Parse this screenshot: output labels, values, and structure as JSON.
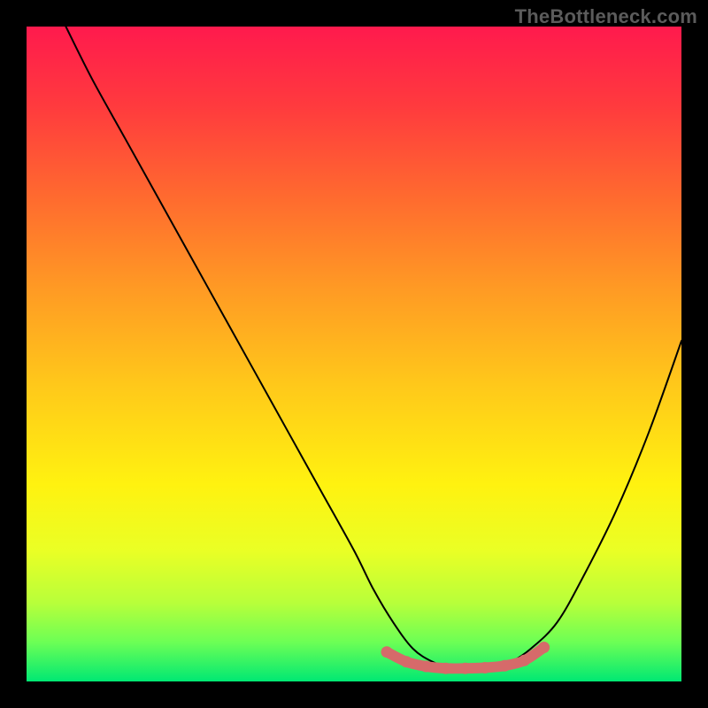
{
  "watermark": "TheBottleneck.com",
  "colors": {
    "background": "#000000",
    "curve_stroke": "#000000",
    "bottom_marker": "#d66a6a",
    "gradient_top": "#ff1a4d",
    "gradient_bottom": "#00e873"
  },
  "chart_data": {
    "type": "line",
    "title": "",
    "xlabel": "",
    "ylabel": "",
    "xlim": [
      0,
      100
    ],
    "ylim": [
      0,
      100
    ],
    "grid": false,
    "series": [
      {
        "name": "bottleneck-curve",
        "x": [
          6,
          10,
          15,
          20,
          25,
          30,
          35,
          40,
          45,
          50,
          53,
          56,
          59,
          62,
          65,
          68,
          71,
          74,
          77,
          81,
          85,
          90,
          95,
          100
        ],
        "y": [
          100,
          92,
          83,
          74,
          65,
          56,
          47,
          38,
          29,
          20,
          14,
          9,
          5,
          3,
          2,
          2,
          2,
          3,
          5,
          9,
          16,
          26,
          38,
          52
        ]
      }
    ],
    "bottom_segment": {
      "name": "optimal-range",
      "points": [
        {
          "x": 55,
          "y": 4.5
        },
        {
          "x": 58,
          "y": 3.0
        },
        {
          "x": 61,
          "y": 2.3
        },
        {
          "x": 64,
          "y": 2.0
        },
        {
          "x": 67,
          "y": 2.0
        },
        {
          "x": 70,
          "y": 2.1
        },
        {
          "x": 73,
          "y": 2.4
        },
        {
          "x": 76,
          "y": 3.2
        },
        {
          "x": 79,
          "y": 5.2
        }
      ],
      "stroke_width_pct": 1.6
    }
  }
}
